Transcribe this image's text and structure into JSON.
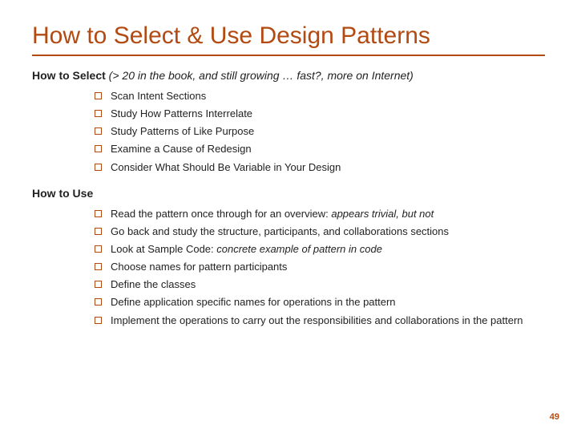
{
  "title": "How to Select & Use Design Patterns",
  "sections": [
    {
      "heading_bold": "How to Select",
      "heading_sub": " (> 20 in the book, and still growing … fast?, more on Internet)",
      "items": [
        {
          "text": "Scan Intent Sections"
        },
        {
          "text": "Study How Patterns Interrelate"
        },
        {
          "text": "Study Patterns of Like Purpose"
        },
        {
          "text": "Examine a Cause of Redesign"
        },
        {
          "text": "Consider What Should Be Variable in Your Design"
        }
      ]
    },
    {
      "heading_bold": "How to Use",
      "heading_sub": "",
      "items": [
        {
          "text": "Read the pattern once through for an overview: ",
          "italic_tail": "appears trivial, but not"
        },
        {
          "text": "Go back and study the structure, participants, and collaborations sections"
        },
        {
          "text": "Look at Sample Code: ",
          "italic_tail": "concrete example of pattern in code"
        },
        {
          "text": "Choose names for pattern participants"
        },
        {
          "text": "Define the classes"
        },
        {
          "text": "Define application specific names for operations in the pattern"
        },
        {
          "text": "Implement the operations to carry out the responsibilities and collaborations in the pattern"
        }
      ]
    }
  ],
  "page_number": "49"
}
